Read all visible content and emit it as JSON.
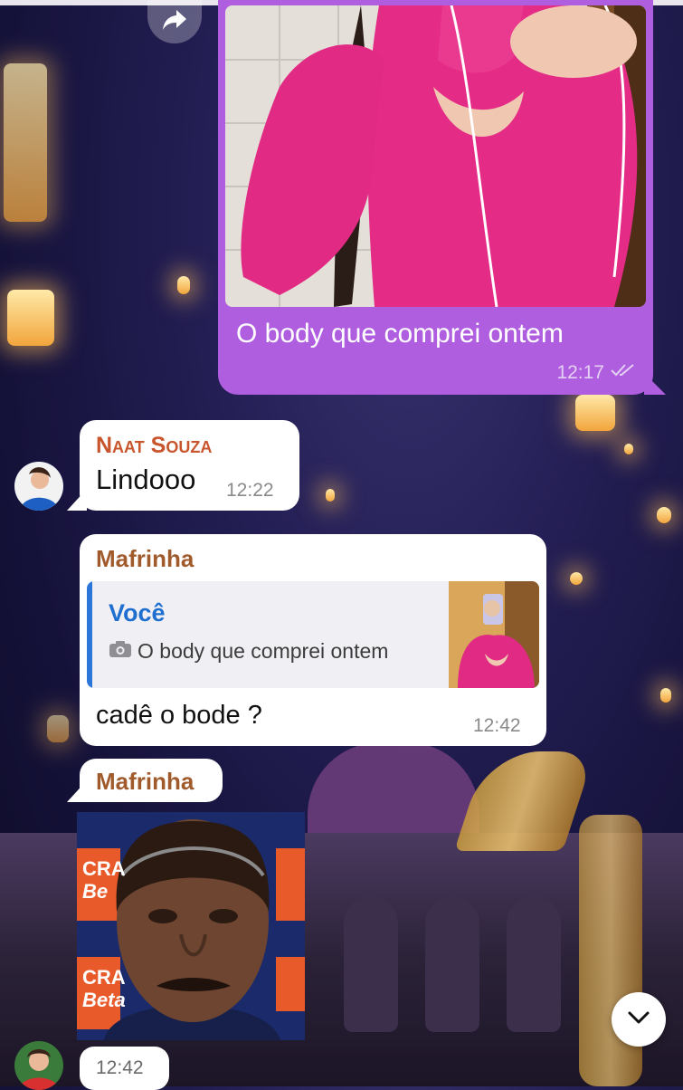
{
  "messages": {
    "outgoing_photo": {
      "caption": "O body que comprei ontem",
      "time": "12:17"
    },
    "msg_naat": {
      "sender": "Naat Souza",
      "text": "Lindooo",
      "time": "12:22"
    },
    "msg_mafrinha_reply": {
      "sender": "Mafrinha",
      "reply_to_sender": "Você",
      "reply_to_text": "O body que comprei ontem",
      "text": "cadê o bode ?",
      "time": "12:42"
    },
    "msg_mafrinha_photo": {
      "sender": "Mafrinha",
      "time": "12:42",
      "photo_sponsor_text_1": "CRA",
      "photo_sponsor_text_2": "Be",
      "photo_sponsor_text_3": "CRA",
      "photo_sponsor_text_4": "Beta"
    }
  },
  "icons": {
    "forward": "forward-icon",
    "read_receipt": "double-check-icon",
    "camera": "camera-icon",
    "scroll_down": "chevron-down-icon"
  },
  "colors": {
    "outgoing_bubble": "#b05ee0",
    "incoming_bubble": "#ffffff",
    "naat_name": "#c8552c",
    "mafrinha_name": "#a05a2c",
    "reply_accent": "#2d76d9",
    "reply_sender": "#1f6fd1"
  }
}
